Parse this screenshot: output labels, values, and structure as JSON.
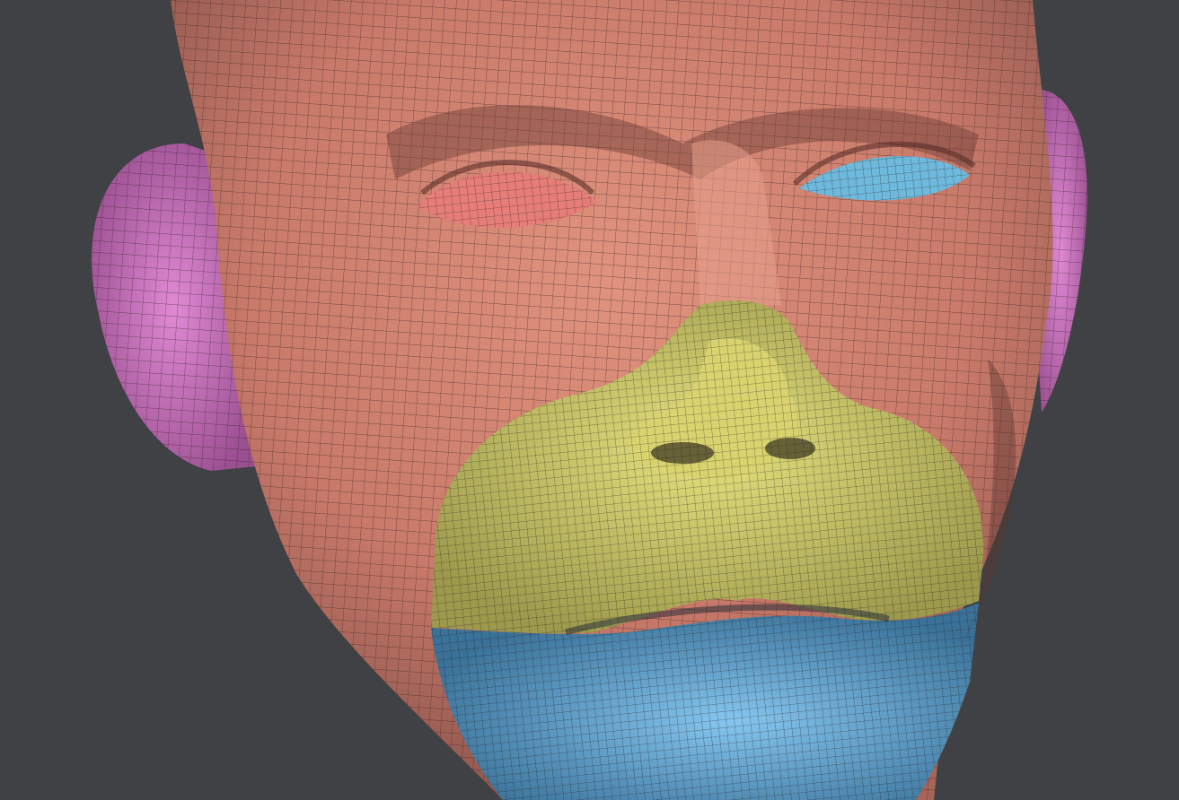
{
  "viewport": {
    "background": "#3f4144",
    "polygroups": [
      {
        "name": "head",
        "color": "#c97a6a"
      },
      {
        "name": "ears",
        "color": "#c46ab8"
      },
      {
        "name": "left-eye",
        "color": "#e77d78"
      },
      {
        "name": "right-eye",
        "color": "#6fb9dc"
      },
      {
        "name": "nose-upper-lip",
        "color": "#c7c46a"
      },
      {
        "name": "lower-lip-chin",
        "color": "#5b9fcf"
      }
    ],
    "wireframe_color": "#2a1c1c"
  }
}
